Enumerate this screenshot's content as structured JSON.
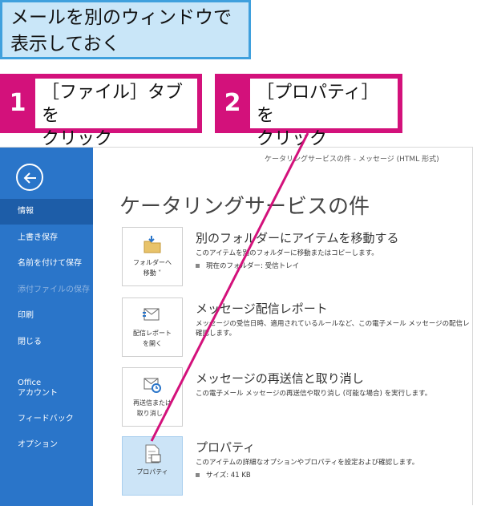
{
  "heading": {
    "text": "メールを別のウィンドウで\n表示しておく"
  },
  "steps": [
    {
      "number": "1",
      "text": "［ファイル］タブを\nクリック"
    },
    {
      "number": "2",
      "text": "［プロパティ］を\nクリック"
    }
  ],
  "window": {
    "title": "ケータリングサービスの件  -  メッセージ (HTML 形式)",
    "mail_heading": "ケータリングサービスの件"
  },
  "sidebar": {
    "back_icon": "back-arrow-icon",
    "items": [
      {
        "label": "情報",
        "state": "active"
      },
      {
        "label": "上書き保存",
        "state": "normal"
      },
      {
        "label": "名前を付けて保存",
        "state": "normal"
      },
      {
        "label": "添付ファイルの保存",
        "state": "disabled"
      },
      {
        "label": "印刷",
        "state": "normal"
      },
      {
        "label": "閉じる",
        "state": "normal"
      },
      {
        "label": "Office\nアカウント",
        "state": "normal"
      },
      {
        "label": "フィードバック",
        "state": "normal"
      },
      {
        "label": "オプション",
        "state": "normal"
      }
    ]
  },
  "items": [
    {
      "icon": "move-folder-icon",
      "icon_label": "フォルダーへ\n移動 ˅",
      "title": "別のフォルダーにアイテムを移動する",
      "description": "このアイテムを別のフォルダーに移動またはコピーします。",
      "detail": "現在のフォルダー:  受信トレイ"
    },
    {
      "icon": "delivery-report-icon",
      "icon_label": "配信レポート\nを開く",
      "title": "メッセージ配信レポート",
      "description": "メッセージの受信日時、適用されているルールなど、この電子メール メッセージの配信レ",
      "detail": "確認します。"
    },
    {
      "icon": "resend-icon",
      "icon_label": "再送信または\n取り消し ˅",
      "title": "メッセージの再送信と取り消し",
      "description": "この電子メール メッセージの再送信や取り消し (可能な場合) を実行します。",
      "detail": ""
    },
    {
      "icon": "properties-icon",
      "icon_label": "プロパティ",
      "title": "プロパティ",
      "description": "このアイテムの詳細なオプションやプロパティを設定および確認します。",
      "detail": "サイズ:   41 KB"
    }
  ],
  "colors": {
    "callout": "#d3117b",
    "sidebar": "#2a75c9",
    "sidebar_active": "#1d5da8",
    "title_bg": "#c9e6f8",
    "title_border": "#3fa0dd"
  }
}
